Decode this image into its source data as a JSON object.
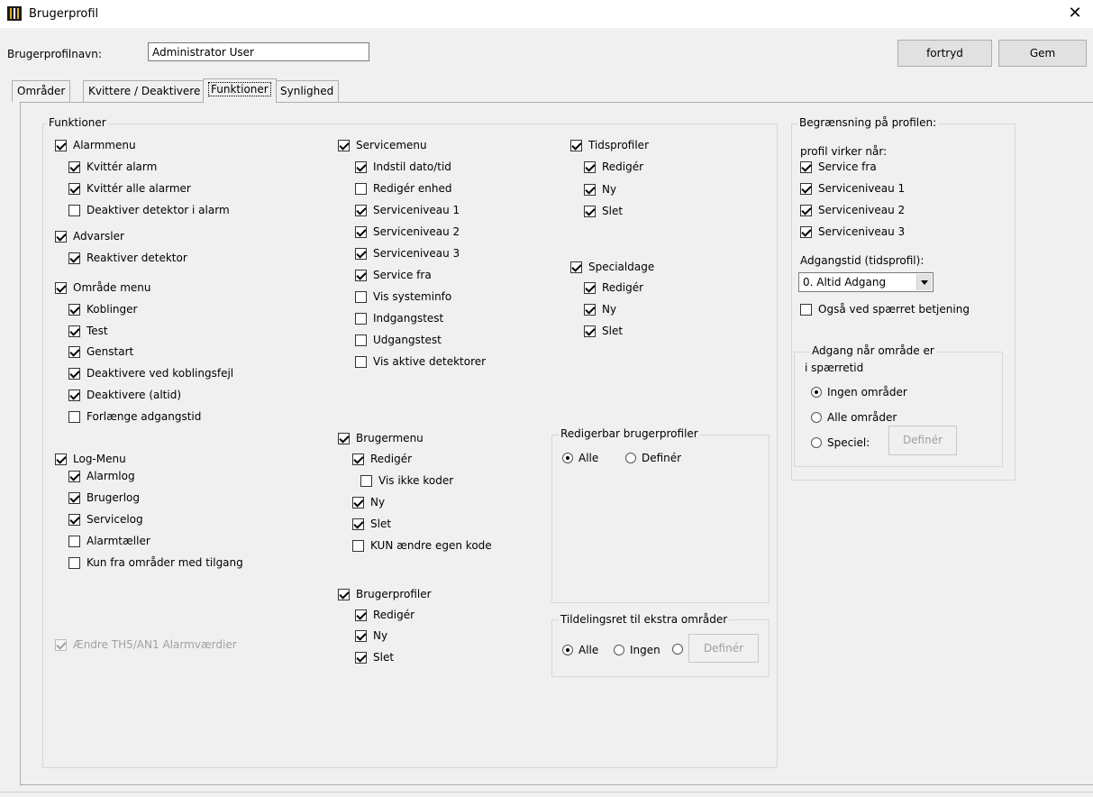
{
  "window": {
    "title": "Brugerprofil",
    "close_glyph": "✕"
  },
  "header": {
    "name_label": "Brugerprofilnavn:",
    "name_value": "Administrator User",
    "cancel_label": "fortryd",
    "save_label": "Gem"
  },
  "tabs": [
    {
      "label": "Områder"
    },
    {
      "label": "Kvittere / Deaktivere"
    },
    {
      "label": "Funktioner",
      "active": true
    },
    {
      "label": "Synlighed"
    }
  ],
  "funktioner": {
    "group_title": "Funktioner",
    "col1": {
      "alarmmenu": "Alarmmenu",
      "kvitter_alarm": "Kvittér alarm",
      "kvitter_alle": "Kvittér alle alarmer",
      "deaktiver_detektor": "Deaktiver detektor i alarm",
      "advarsler": "Advarsler",
      "reaktiver": "Reaktiver detektor",
      "omraade_menu": "Område menu",
      "koblinger": "Koblinger",
      "test": "Test",
      "genstart": "Genstart",
      "deaktivere_koblingsfejl": "Deaktivere ved koblingsfejl",
      "deaktivere_altid": "Deaktivere (altid)",
      "forlaenge": "Forlænge adgangstid",
      "log_menu": "Log-Menu",
      "alarmlog": "Alarmlog",
      "brugerlog": "Brugerlog",
      "servicelog": "Servicelog",
      "alarmtaeller": "Alarmtæller",
      "kun_fra": "Kun fra områder med tilgang",
      "aendre_ths": "Ændre TH5/AN1 Alarmværdier"
    },
    "col2": {
      "servicemenu": "Servicemenu",
      "indstil": "Indstil dato/tid",
      "rediger_enhed": "Redigér enhed",
      "serviceniveau1": "Serviceniveau 1",
      "serviceniveau2": "Serviceniveau 2",
      "serviceniveau3": "Serviceniveau 3",
      "service_fra": "Service fra",
      "vis_systeminfo": "Vis systeminfo",
      "indgangstest": "Indgangstest",
      "udgangstest": "Udgangstest",
      "vis_aktive": "Vis aktive detektorer",
      "brugermenu": "Brugermenu",
      "bm_rediger": "Redigér",
      "vis_ikke_koder": "Vis ikke koder",
      "bm_ny": "Ny",
      "bm_slet": "Slet",
      "kun_aendre": "KUN ændre egen kode",
      "brugerprofiler": "Brugerprofiler",
      "bp_rediger": "Redigér",
      "bp_ny": "Ny",
      "bp_slet": "Slet"
    },
    "col3": {
      "tidsprofiler": "Tidsprofiler",
      "tp_rediger": "Redigér",
      "tp_ny": "Ny",
      "tp_slet": "Slet",
      "specialdage": "Specialdage",
      "sd_rediger": "Redigér",
      "sd_ny": "Ny",
      "sd_slet": "Slet"
    },
    "redigerbar": {
      "title": "Redigerbar brugerprofiler",
      "alle": "Alle",
      "definer": "Definér"
    },
    "tildeling": {
      "title": "Tildelingsret til ekstra områder",
      "alle": "Alle",
      "ingen": "Ingen",
      "definer_btn": "Definér"
    }
  },
  "begraensning": {
    "title": "Begrænsning på profilen:",
    "virker_label": "profil virker når:",
    "service_fra": "Service fra",
    "serviceniveau1": "Serviceniveau 1",
    "serviceniveau2": "Serviceniveau 2",
    "serviceniveau3": "Serviceniveau 3",
    "adgangstid_label": "Adgangstid (tidsprofil):",
    "adgangstid_value": "0. Altid Adgang",
    "ogsaa_spaerret": "Også ved spærret betjening",
    "adgang_title_line1": "Adgang når område er",
    "adgang_title_line2": "i spærretid",
    "ingen_omraader": "Ingen områder",
    "alle_omraader": "Alle områder",
    "speciel": "Speciel:",
    "definer_btn": "Definér"
  }
}
